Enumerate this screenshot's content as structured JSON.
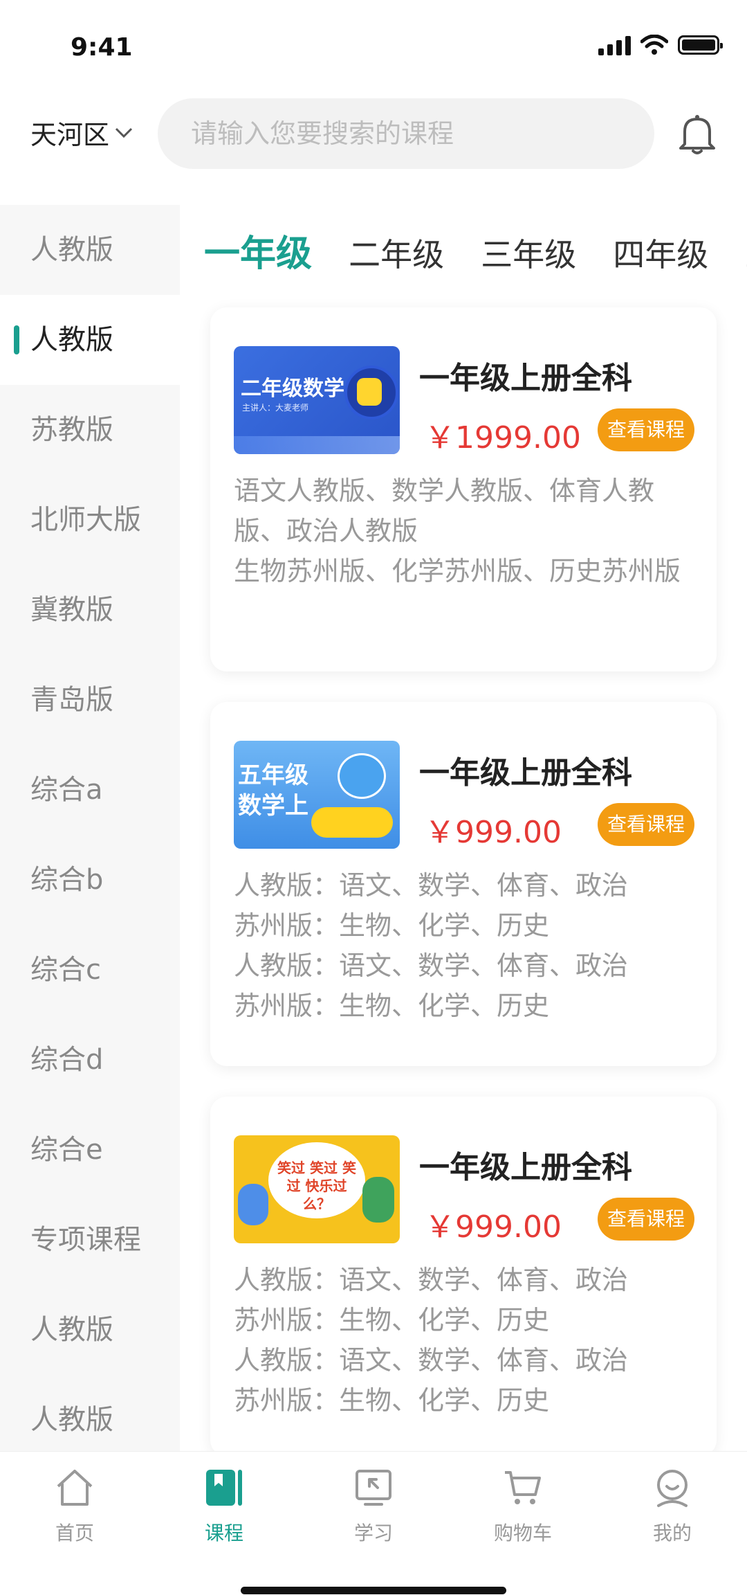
{
  "status_bar": {
    "time": "9:41"
  },
  "header": {
    "location": "天河区",
    "search_placeholder": "请输入您要搜索的课程"
  },
  "sidebar": {
    "items": [
      {
        "label": "人教版"
      },
      {
        "label": "人教版"
      },
      {
        "label": "苏教版"
      },
      {
        "label": "北师大版"
      },
      {
        "label": "冀教版"
      },
      {
        "label": "青岛版"
      },
      {
        "label": "综合a"
      },
      {
        "label": "综合b"
      },
      {
        "label": "综合c"
      },
      {
        "label": "综合d"
      },
      {
        "label": "综合e"
      },
      {
        "label": "专项课程"
      },
      {
        "label": "人教版"
      },
      {
        "label": "人教版"
      }
    ],
    "active_index": 1
  },
  "tabs": [
    {
      "label": "一年级"
    },
    {
      "label": "二年级"
    },
    {
      "label": "三年级"
    },
    {
      "label": "四年级"
    },
    {
      "label": "五"
    }
  ],
  "courses": [
    {
      "title": "一年级上册全科",
      "price": "￥1999.00",
      "button": "查看课程",
      "thumb_text": "二年级数学上",
      "thumb_sub": "主讲人：大麦老师",
      "desc": [
        "语文人教版、数学人教版、体育人教版、政治人教版",
        "生物苏州版、化学苏州版、历史苏州版"
      ]
    },
    {
      "title": "一年级上册全科",
      "price": "￥999.00",
      "button": "查看课程",
      "thumb_line1": "五年级",
      "thumb_line2": "数学上",
      "desc": [
        "人教版：语文、数学、体育、政治",
        "苏州版：生物、化学、历史",
        "人教版：语文、数学、体育、政治",
        "苏州版：生物、化学、历史"
      ]
    },
    {
      "title": "一年级上册全科",
      "price": "￥999.00",
      "button": "查看课程",
      "thumb_text": "笑过 笑过 笑过 快乐过么？",
      "desc": [
        "人教版：语文、数学、体育、政治",
        "苏州版：生物、化学、历史",
        "人教版：语文、数学、体育、政治",
        "苏州版：生物、化学、历史"
      ]
    }
  ],
  "bottom_nav": [
    {
      "label": "首页",
      "icon": "home-icon"
    },
    {
      "label": "课程",
      "icon": "course-icon"
    },
    {
      "label": "学习",
      "icon": "study-icon"
    },
    {
      "label": "购物车",
      "icon": "cart-icon"
    },
    {
      "label": "我的",
      "icon": "profile-icon"
    }
  ],
  "colors": {
    "accent": "#1a9f8f",
    "price": "#e53935",
    "button": "#f39c12"
  }
}
